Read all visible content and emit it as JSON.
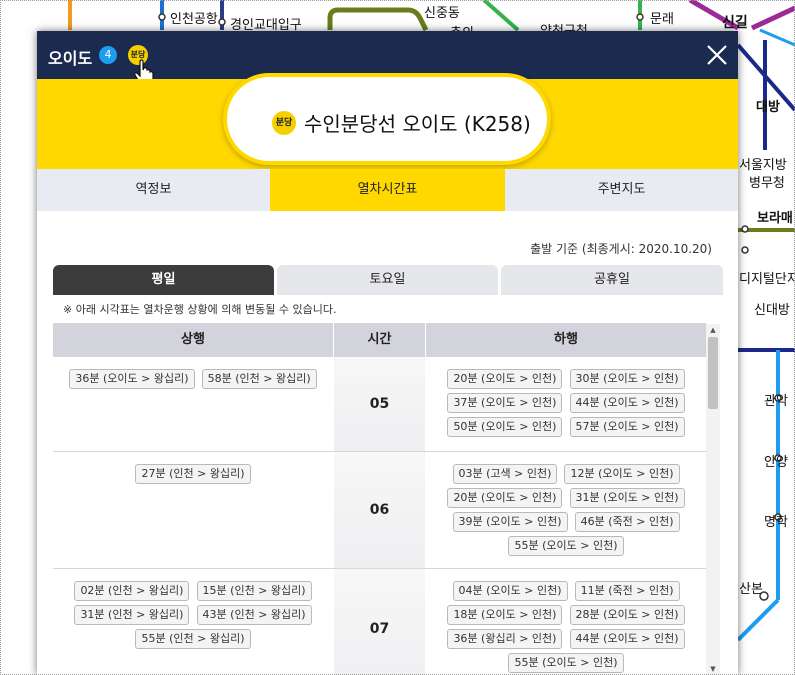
{
  "map": {
    "labels": [
      {
        "text": "인천공항",
        "bold": false
      },
      {
        "text": "경인교대입구",
        "bold": false
      },
      {
        "text": "신중동",
        "bold": false
      },
      {
        "text": "춘의",
        "bold": false
      },
      {
        "text": "양천구청",
        "bold": false
      },
      {
        "text": "문래",
        "bold": false
      },
      {
        "text": "신길",
        "bold": true
      },
      {
        "text": "대방",
        "bold": true
      },
      {
        "text": "서울지방",
        "bold": false
      },
      {
        "text": "병무청",
        "bold": false
      },
      {
        "text": "보라매",
        "bold": true
      },
      {
        "text": "디지털단지",
        "bold": false
      },
      {
        "text": "신대방",
        "bold": false
      },
      {
        "text": "관악",
        "bold": false
      },
      {
        "text": "안양",
        "bold": false
      },
      {
        "text": "명학",
        "bold": false
      },
      {
        "text": "산본",
        "bold": false
      }
    ]
  },
  "modal": {
    "title": "오이도",
    "line_badge": "4",
    "bundang_badge": "분당",
    "close_icon": "close-icon",
    "banner": {
      "badge": "분당",
      "station_name": "수인분당선 오이도 (K258)"
    },
    "tabs": [
      {
        "label": "역정보",
        "active": false
      },
      {
        "label": "열차시간표",
        "active": true
      },
      {
        "label": "주변지도",
        "active": false
      }
    ],
    "timetable": {
      "posted_note": "출발 기준 (최종게시: 2020.10.20)",
      "day_tabs": [
        {
          "label": "평일",
          "active": true
        },
        {
          "label": "토요일",
          "active": false
        },
        {
          "label": "공휴일",
          "active": false
        }
      ],
      "notice": "※ 아래 시각표는 열차운행 상황에 의해 변동될 수 있습니다.",
      "headers": {
        "up": "상행",
        "hour": "시간",
        "down": "하행"
      },
      "rows": [
        {
          "hour": "05",
          "up": [
            "36분 (오이도 > 왕십리)",
            "58분 (인천 > 왕십리)"
          ],
          "down": [
            "20분 (오이도 > 인천)",
            "30분 (오이도 > 인천)",
            "37분 (오이도 > 인천)",
            "44분 (오이도 > 인천)",
            "50분 (오이도 > 인천)",
            "57분 (오이도 > 인천)"
          ]
        },
        {
          "hour": "06",
          "up": [
            "27분 (인천 > 왕십리)"
          ],
          "down": [
            "03분 (고색 > 인천)",
            "12분 (오이도 > 인천)",
            "20분 (오이도 > 인천)",
            "31분 (오이도 > 인천)",
            "39분 (오이도 > 인천)",
            "46분 (죽전 > 인천)",
            "55분 (오이도 > 인천)"
          ]
        },
        {
          "hour": "07",
          "up": [
            "02분 (인천 > 왕십리)",
            "15분 (인천 > 왕십리)",
            "31분 (인천 > 왕십리)",
            "43분 (인천 > 왕십리)",
            "55분 (인천 > 왕십리)"
          ],
          "down": [
            "04분 (오이도 > 인천)",
            "11분 (죽전 > 인천)",
            "18분 (오이도 > 인천)",
            "28분 (오이도 > 인천)",
            "36분 (왕십리 > 인천)",
            "44분 (오이도 > 인천)",
            "55분 (오이도 > 인천)"
          ]
        }
      ]
    }
  },
  "colors": {
    "header_bg": "#1b2a4f",
    "bundang_yellow": "#ffd800",
    "line4_blue": "#1e9cf0",
    "active_day_tab": "#3c3c3c"
  }
}
